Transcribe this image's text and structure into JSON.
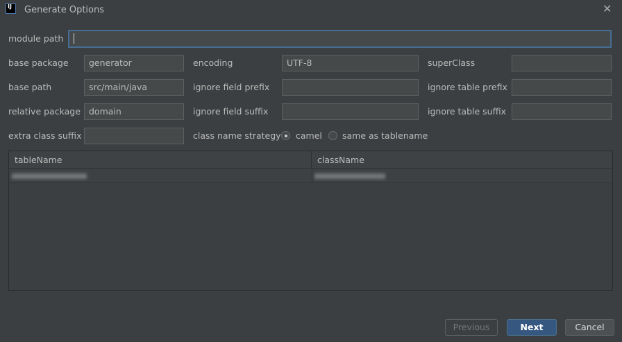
{
  "window": {
    "title": "Generate Options",
    "logo": "IJ"
  },
  "form": {
    "module_path": {
      "label": "module path",
      "value": ""
    },
    "base_package": {
      "label": "base package",
      "value": "generator"
    },
    "encoding": {
      "label": "encoding",
      "value": "UTF-8"
    },
    "super_class": {
      "label": "superClass",
      "value": ""
    },
    "base_path": {
      "label": "base path",
      "value": "src/main/java"
    },
    "ignore_field_prefix": {
      "label": "ignore field prefix",
      "value": ""
    },
    "ignore_table_prefix": {
      "label": "ignore table prefix",
      "value": ""
    },
    "relative_package": {
      "label": "relative package",
      "value": "domain"
    },
    "ignore_field_suffix": {
      "label": "ignore field suffix",
      "value": ""
    },
    "ignore_table_suffix": {
      "label": "ignore table suffix",
      "value": ""
    },
    "extra_class_suffix": {
      "label": "extra class suffix",
      "value": ""
    },
    "class_name_strategy": {
      "label": "class name strategy",
      "options": [
        "camel",
        "same as tablename"
      ],
      "selected": "camel"
    }
  },
  "table": {
    "columns": [
      "tableName",
      "className"
    ]
  },
  "buttons": {
    "previous": "Previous",
    "next": "Next",
    "cancel": "Cancel"
  }
}
